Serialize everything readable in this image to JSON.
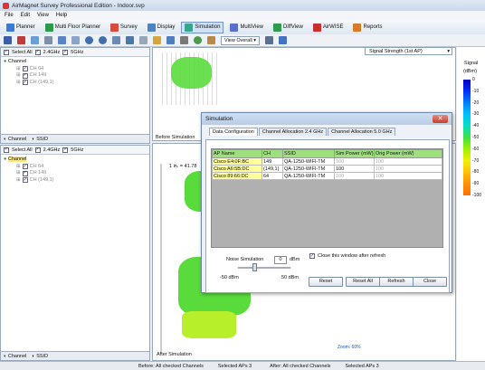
{
  "window": {
    "title": "AirMagnet Survey Professional Edition - Indoor.svp"
  },
  "menu": [
    "File",
    "Edit",
    "View",
    "Help"
  ],
  "tabs": [
    {
      "label": "Planner",
      "icon": "planner-icon"
    },
    {
      "label": "Multi Floor Planner",
      "icon": "multi-floor-icon"
    },
    {
      "label": "Survey",
      "icon": "survey-icon"
    },
    {
      "label": "Display",
      "icon": "display-icon"
    },
    {
      "label": "Simulation",
      "icon": "simulation-icon",
      "active": true
    },
    {
      "label": "MultiView",
      "icon": "multiview-icon"
    },
    {
      "label": "DiffView",
      "icon": "diffview-icon"
    },
    {
      "label": "AirWISE",
      "icon": "airwise-icon"
    },
    {
      "label": "Reports",
      "icon": "reports-icon"
    }
  ],
  "toolbar": {
    "view_select": "View Overall"
  },
  "signal_select": "Signal Strength (1st AP)",
  "top_panel": {
    "select_all": "Select All",
    "ghz24": "2.4GHz",
    "ghz5": "5GHz",
    "root": "Channel",
    "channels": [
      "CH 64",
      "CH 149",
      "CH (149,1)"
    ],
    "tab_channel": "Channel",
    "tab_ssid": "SSID"
  },
  "bottom_panel": {
    "select_all": "Select All",
    "ghz24": "2.4GHz",
    "ghz5": "5GHz",
    "root": "Channel",
    "channels": [
      "CH 64",
      "CH 149",
      "CH (149,1)"
    ],
    "tab_channel": "Channel",
    "tab_ssid": "SSID"
  },
  "maps": {
    "before_label": "Before Simulation",
    "scale_label": "1 in. = 41.78",
    "after_label": "After Simulation",
    "zoom": "Zoom: 60%"
  },
  "legend": {
    "title": "Signal",
    "unit": "(dBm)",
    "ticks": [
      "0",
      "-10",
      "-20",
      "-30",
      "-40",
      "-50",
      "-60",
      "-70",
      "-80",
      "-90",
      "-100"
    ],
    "colors": [
      "#0000c0",
      "#0030ff",
      "#0080ff",
      "#00c0ff",
      "#00e0c0",
      "#40e040",
      "#a0f000",
      "#f0f000",
      "#ffc000",
      "#ff9000",
      "#ff7000"
    ]
  },
  "dialog": {
    "title": "Simulation",
    "tabs": [
      "Data Configuration",
      "Channel Allocation 2.4 GHz",
      "Channel Allocation 5.0 GHz"
    ],
    "columns": [
      "AP Name",
      "CH",
      "SSID",
      "Sim Power (mW)",
      "Orig Power (mW)"
    ],
    "rows": [
      {
        "ap": "Cisco E4:0F:BC",
        "ch": "149",
        "ssid": "QA-1250-WIFI-TM",
        "sim": "100",
        "orig": "100"
      },
      {
        "ap": "Cisco A6:5B:DC",
        "ch": "(149,1)",
        "ssid": "QA-1250-WIFI-TM",
        "sim": "100",
        "orig": "100"
      },
      {
        "ap": "Cisco 89:66:DC",
        "ch": "64",
        "ssid": "QA-1250-WIFI-TM",
        "sim": "100",
        "orig": "100"
      }
    ],
    "noise_label": "Noise Simulation",
    "noise_value": "0",
    "noise_unit": "dBm",
    "slider_min": "-50 dBm",
    "slider_max": "50 dBm",
    "close_after_refresh": "Close this window after refresh",
    "buttons": {
      "reset": "Reset",
      "reset_all": "Reset All",
      "refresh": "Refresh",
      "close": "Close"
    }
  },
  "status": {
    "before": "Before: All checked Channels",
    "before_aps": "Selected APs 3",
    "after": "After: All checked Channels",
    "after_aps": "Selected APs 3"
  }
}
